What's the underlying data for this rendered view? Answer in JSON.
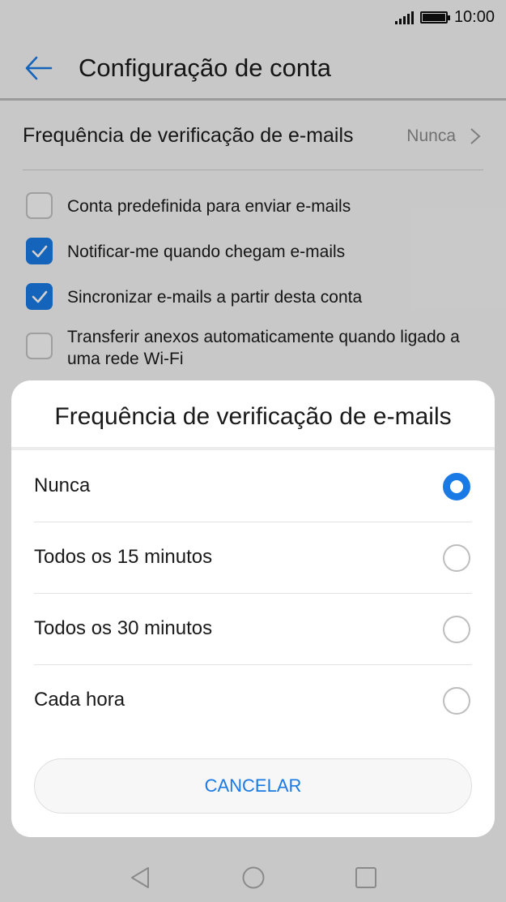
{
  "status_bar": {
    "time": "10:00",
    "signal_icon": "signal-icon",
    "battery_icon": "battery-icon"
  },
  "header": {
    "title": "Configuração de conta",
    "back_icon": "arrow-left-icon"
  },
  "settings": {
    "frequency": {
      "label": "Frequência de verificação de e-mails",
      "value": "Nunca"
    },
    "checkboxes": [
      {
        "label": "Conta predefinida para enviar e-mails",
        "checked": false
      },
      {
        "label": "Notificar-me quando chegam e-mails",
        "checked": true
      },
      {
        "label": "Sincronizar e-mails a partir desta conta",
        "checked": true
      },
      {
        "label": "Transferir anexos automaticamente quando ligado a uma rede Wi-Fi",
        "checked": false
      }
    ]
  },
  "dialog": {
    "title": "Frequência de verificação de e-mails",
    "options": [
      {
        "label": "Nunca",
        "selected": true
      },
      {
        "label": "Todos os 15 minutos",
        "selected": false
      },
      {
        "label": "Todos os 30 minutos",
        "selected": false
      },
      {
        "label": "Cada hora",
        "selected": false
      }
    ],
    "cancel_label": "CANCELAR"
  },
  "colors": {
    "accent": "#1a7ae5",
    "background": "#f5f5f5"
  }
}
